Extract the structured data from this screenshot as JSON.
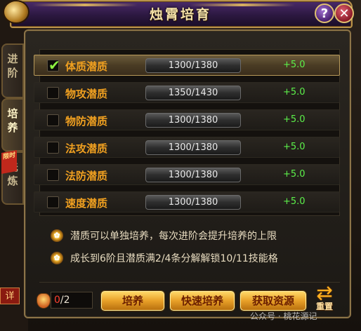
{
  "window": {
    "title": "烛霄培育",
    "help_label": "?",
    "close_label": "✕"
  },
  "side_tabs": [
    {
      "label": "进阶",
      "active": false
    },
    {
      "label": "培养",
      "active": true
    },
    {
      "label": "洗炼",
      "active": false,
      "ribbon": "限时"
    }
  ],
  "rows": [
    {
      "label": "体质潜质",
      "value": "1300/1380",
      "bonus": "+5.0",
      "checked": true
    },
    {
      "label": "物攻潜质",
      "value": "1350/1430",
      "bonus": "+5.0",
      "checked": false
    },
    {
      "label": "物防潜质",
      "value": "1300/1380",
      "bonus": "+5.0",
      "checked": false
    },
    {
      "label": "法攻潜质",
      "value": "1300/1380",
      "bonus": "+5.0",
      "checked": false
    },
    {
      "label": "法防潜质",
      "value": "1300/1380",
      "bonus": "+5.0",
      "checked": false
    },
    {
      "label": "速度潜质",
      "value": "1300/1380",
      "bonus": "+5.0",
      "checked": false
    }
  ],
  "notes": [
    "潜质可以单独培养，每次进阶会提升培养的上限",
    "成长到6阶且潜质满2/4条分解解锁10/11技能格"
  ],
  "footer": {
    "count_current": "0",
    "count_total": "/2",
    "train_label": "培养",
    "quick_train_label": "快速培养",
    "get_resource_label": "获取资源",
    "reset_label": "重置",
    "detail_tag": "详"
  },
  "watermark": "公众号 · 桃花源记",
  "colors": {
    "accent": "#f0a020",
    "bonus": "#5cf04a",
    "selected_row": "#6b5a3a",
    "count_current": "#ff4030"
  }
}
